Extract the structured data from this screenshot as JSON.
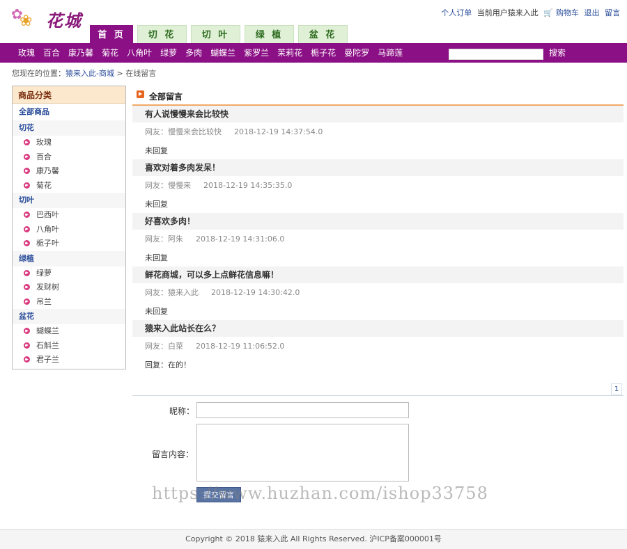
{
  "header": {
    "logo_text": "花城",
    "top_links": {
      "orders": "个人订单",
      "current_user": "当前用户猿来入此",
      "cart": "购物车",
      "logout": "退出",
      "guestbook": "留言"
    },
    "tabs": [
      "首 页",
      "切 花",
      "切 叶",
      "绿 植",
      "盆 花"
    ]
  },
  "nav": {
    "categories": [
      "玫瑰",
      "百合",
      "康乃馨",
      "菊花",
      "八角叶",
      "绿萝",
      "多肉",
      "蝴蝶兰",
      "紫罗兰",
      "茉莉花",
      "栀子花",
      "曼陀罗",
      "马蹄莲"
    ],
    "search_placeholder": "",
    "search_label": "搜索"
  },
  "breadcrumb": {
    "prefix": "您现在的位置：",
    "home": "猿来入此-商城",
    "sep": " > ",
    "current": "在线留言"
  },
  "sidebar": {
    "title": "商品分类",
    "all": "全部商品",
    "groups": [
      {
        "name": "切花",
        "items": [
          "玫瑰",
          "百合",
          "康乃馨",
          "菊花"
        ]
      },
      {
        "name": "切叶",
        "items": [
          "巴西叶",
          "八角叶",
          "栀子叶"
        ]
      },
      {
        "name": "绿植",
        "items": [
          "绿萝",
          "发财树",
          "吊兰"
        ]
      },
      {
        "name": "盆花",
        "items": [
          "蝴蝶兰",
          "石斛兰",
          "君子兰"
        ]
      }
    ]
  },
  "main": {
    "title": "全部留言",
    "messages": [
      {
        "title": "有人说慢慢来会比较快",
        "author": "网友：慢慢来会比较快",
        "time": "2018-12-19 14:37:54.0",
        "reply": "未回复"
      },
      {
        "title": "喜欢对着多肉发呆！",
        "author": "网友：慢慢来",
        "time": "2018-12-19 14:35:35.0",
        "reply": "未回复"
      },
      {
        "title": "好喜欢多肉！",
        "author": "网友：阿朱",
        "time": "2018-12-19 14:31:06.0",
        "reply": "未回复"
      },
      {
        "title": "鲜花商城，可以多上点鲜花信息嘛！",
        "author": "网友：猿来入此",
        "time": "2018-12-19 14:30:42.0",
        "reply": "未回复"
      },
      {
        "title": "猿来入此站长在么？",
        "author": "网友：白菜",
        "time": "2018-12-19 11:06:52.0",
        "reply": "回复：在的！"
      }
    ],
    "page": "1"
  },
  "form": {
    "nick_label": "昵称：",
    "nick_value": "",
    "content_label": "留言内容：",
    "content_value": "",
    "submit_label": "提交留言"
  },
  "watermark": "https://www.huzhan.com/ishop33758",
  "footer": {
    "text": "Copyright © 2018 猿来入此 All Rights Reserved. 沪ICP备案000001号"
  },
  "colors": {
    "brand_purple": "#8b0f85",
    "tab_green": "#dff0d6",
    "accent_orange": "#e7641e",
    "link_blue": "#2a4d9a"
  }
}
